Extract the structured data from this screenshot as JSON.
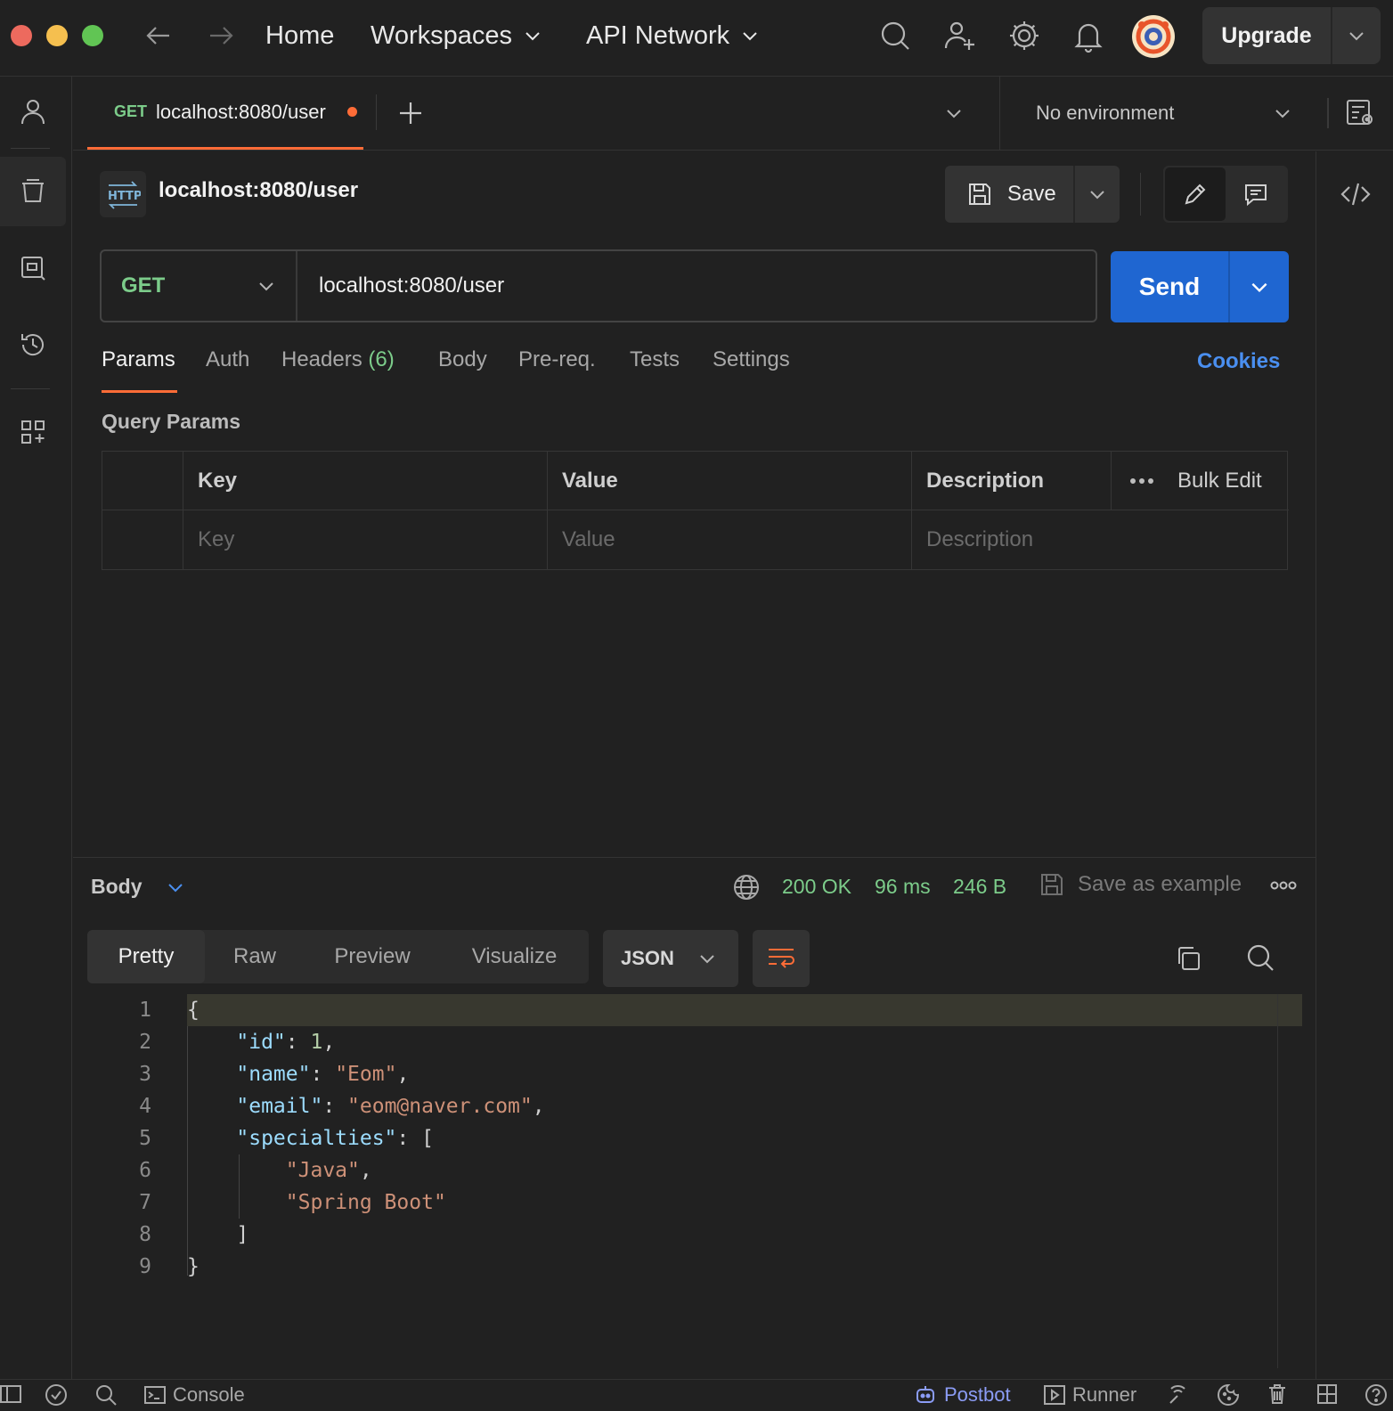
{
  "titlebar": {
    "home": "Home",
    "workspaces": "Workspaces",
    "api_network": "API Network",
    "upgrade": "Upgrade"
  },
  "tab": {
    "method": "GET",
    "url": "localhost:8080/user"
  },
  "environment": "No environment",
  "request": {
    "title": "localhost:8080/user",
    "save_label": "Save",
    "method": "GET",
    "url": "localhost:8080/user",
    "send_label": "Send"
  },
  "request_tabs": {
    "params": "Params",
    "auth": "Auth",
    "headers": "Headers",
    "headers_count": "(6)",
    "body": "Body",
    "prereq": "Pre-req.",
    "tests": "Tests",
    "settings": "Settings",
    "cookies": "Cookies"
  },
  "query_params": {
    "title": "Query Params",
    "columns": {
      "key": "Key",
      "value": "Value",
      "description": "Description"
    },
    "bulk_edit": "Bulk Edit",
    "placeholders": {
      "key": "Key",
      "value": "Value",
      "description": "Description"
    }
  },
  "response": {
    "section_label": "Body",
    "status": "200 OK",
    "time": "96 ms",
    "size": "246 B",
    "save_example": "Save as example",
    "views": [
      "Pretty",
      "Raw",
      "Preview",
      "Visualize"
    ],
    "format": "JSON",
    "code_lines": [
      {
        "no": "1",
        "html": "{"
      },
      {
        "no": "2",
        "html": "    <span class='k'>\"id\"</span>: <span class='n'>1</span>,"
      },
      {
        "no": "3",
        "html": "    <span class='k'>\"name\"</span>: <span class='s'>\"Eom\"</span>,"
      },
      {
        "no": "4",
        "html": "    <span class='k'>\"email\"</span>: <span class='s'>\"eom@naver.com\"</span>,"
      },
      {
        "no": "5",
        "html": "    <span class='k'>\"specialties\"</span>: ["
      },
      {
        "no": "6",
        "html": "        <span class='s'>\"Java\"</span>,"
      },
      {
        "no": "7",
        "html": "        <span class='s'>\"Spring Boot\"</span>"
      },
      {
        "no": "8",
        "html": "    ]"
      },
      {
        "no": "9",
        "html": "}"
      }
    ]
  },
  "statusbar": {
    "console": "Console",
    "postbot": "Postbot",
    "runner": "Runner"
  },
  "colors": {
    "accent": "#ff6c37",
    "send": "#1f66d1",
    "method_get": "#7ccc8a",
    "link": "#4a8ff0"
  }
}
